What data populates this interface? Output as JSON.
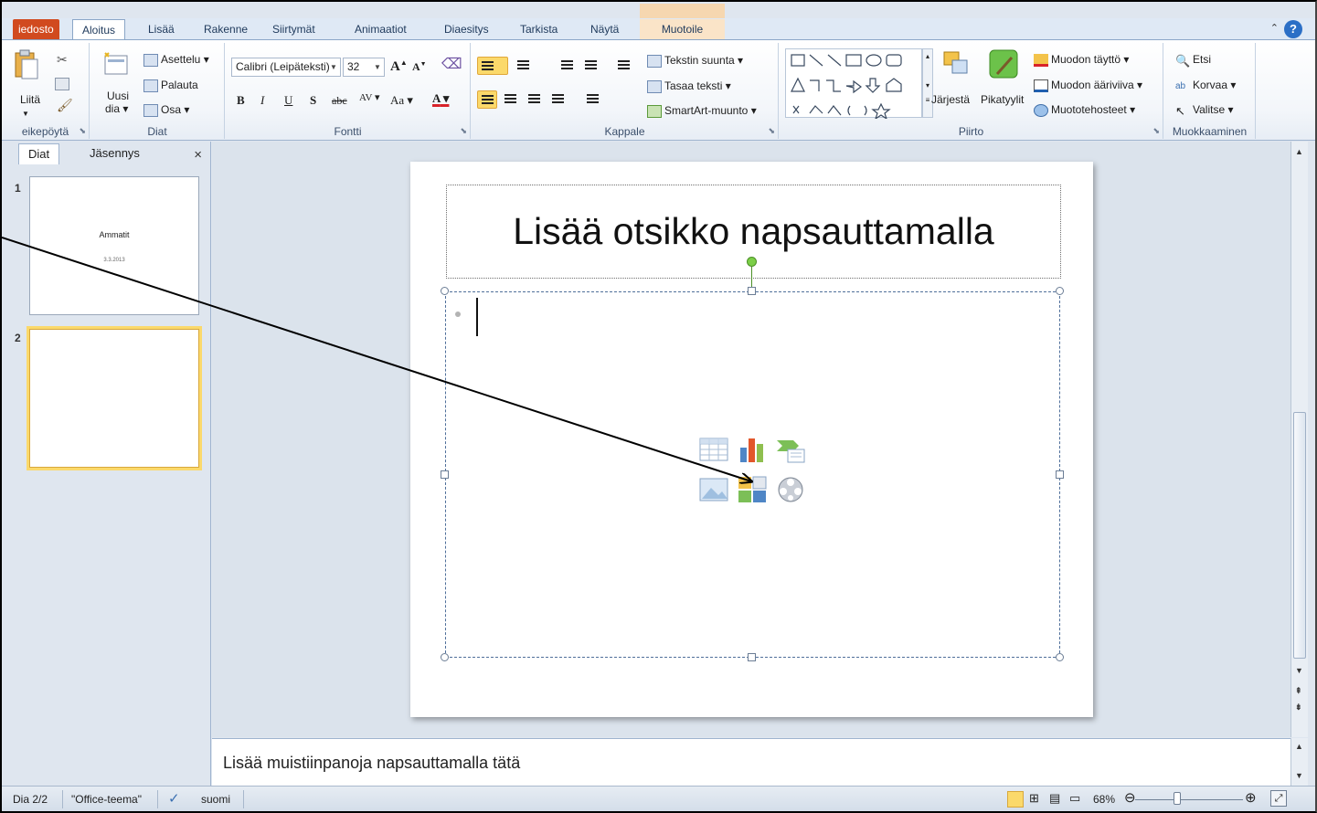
{
  "ribbon_tabs": {
    "file": "iedosto",
    "home": "Aloitus",
    "insert": "Lisää",
    "design": "Rakenne",
    "transitions": "Siirtymät",
    "animations": "Animaatiot",
    "slideshow": "Diaesitys",
    "review": "Tarkista",
    "view": "Näytä",
    "format": "Muotoile"
  },
  "clipboard": {
    "paste": "Liitä",
    "label": "eikepöytä"
  },
  "slides_group": {
    "new_slide_line1": "Uusi",
    "new_slide_line2": "dia",
    "layout": "Asettelu",
    "reset": "Palauta",
    "section": "Osa",
    "label": "Diat"
  },
  "font_group": {
    "font_name": "Calibri (Leipäteksti)",
    "font_size": "32",
    "bold": "B",
    "italic": "I",
    "underline": "U",
    "shadow": "S",
    "strike": "abc",
    "spacing": "AV",
    "case": "Aa",
    "color_a": "A",
    "grow": "A",
    "shrink": "A",
    "label": "Fontti"
  },
  "paragraph_group": {
    "text_direction": "Tekstin suunta",
    "align_text": "Tasaa teksti",
    "smartart": "SmartArt-muunto",
    "label": "Kappale"
  },
  "drawing_group": {
    "arrange": "Järjestä",
    "quick_styles": "Pikatyylit",
    "shape_fill": "Muodon täyttö",
    "shape_outline": "Muodon ääriviiva",
    "shape_effects": "Muototehosteet",
    "label": "Piirto"
  },
  "editing_group": {
    "find": "Etsi",
    "replace": "Korvaa",
    "select": "Valitse",
    "label": "Muokkaaminen"
  },
  "left_panel": {
    "tab_slides": "Diat",
    "tab_outline": "Jäsennys",
    "close": "×",
    "slides": [
      {
        "number": "1",
        "title": "Ammatit",
        "subtitle": "3.3.2013"
      },
      {
        "number": "2",
        "title": "",
        "subtitle": ""
      }
    ]
  },
  "slide": {
    "title_placeholder": "Lisää otsikko napsauttamalla"
  },
  "notes": {
    "placeholder": "Lisää muistiinpanoja napsauttamalla tätä"
  },
  "status_bar": {
    "slide_info": "Dia 2/2",
    "theme": "\"Office-teema\"",
    "language": "suomi",
    "zoom": "68%"
  },
  "accent_colors": {
    "file_tab": "#d14a1f",
    "selected_highlight": "#fbd96b",
    "context_tab": "#f6d7b0",
    "rotate_handle": "#7ccf48"
  }
}
